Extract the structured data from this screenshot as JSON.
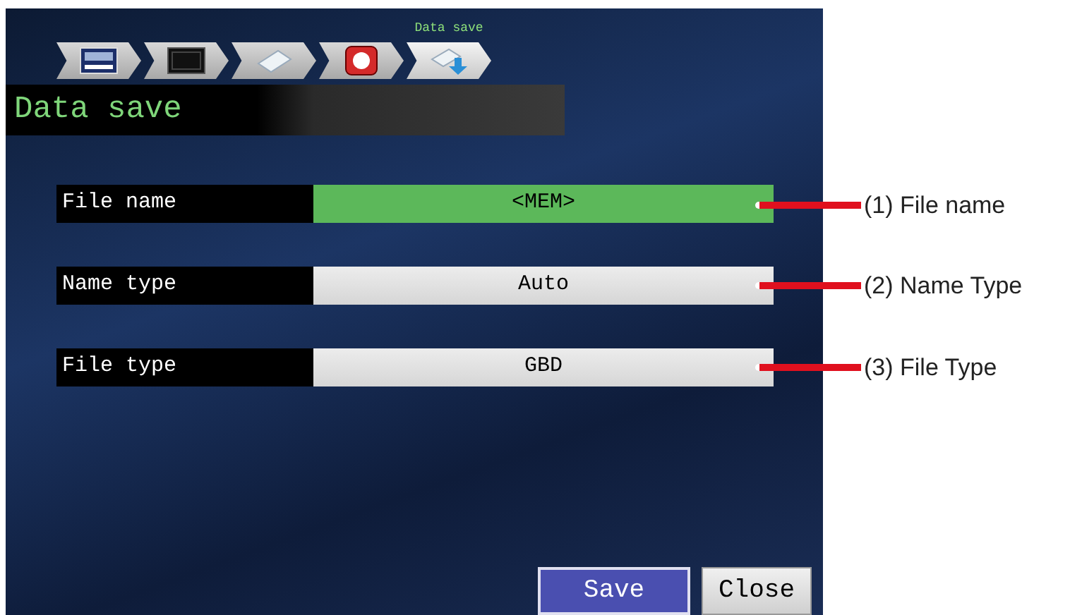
{
  "steps": [
    {
      "kind": "device",
      "selected": false
    },
    {
      "kind": "display",
      "selected": false
    },
    {
      "kind": "paper",
      "selected": false
    },
    {
      "kind": "record",
      "selected": false
    },
    {
      "kind": "save",
      "selected": true
    }
  ],
  "step_caption": "Data save",
  "title": "Data save",
  "settings": [
    {
      "label": "File name",
      "value": "<MEM>",
      "selected": true
    },
    {
      "label": "Name type",
      "value": "Auto",
      "selected": false
    },
    {
      "label": "File type",
      "value": "GBD",
      "selected": false
    }
  ],
  "buttons": [
    {
      "label": "Save",
      "selected": true
    },
    {
      "label": "Close",
      "selected": false
    }
  ],
  "callouts": [
    "(1) File name",
    "(2) Name Type",
    "(3) File Type"
  ]
}
